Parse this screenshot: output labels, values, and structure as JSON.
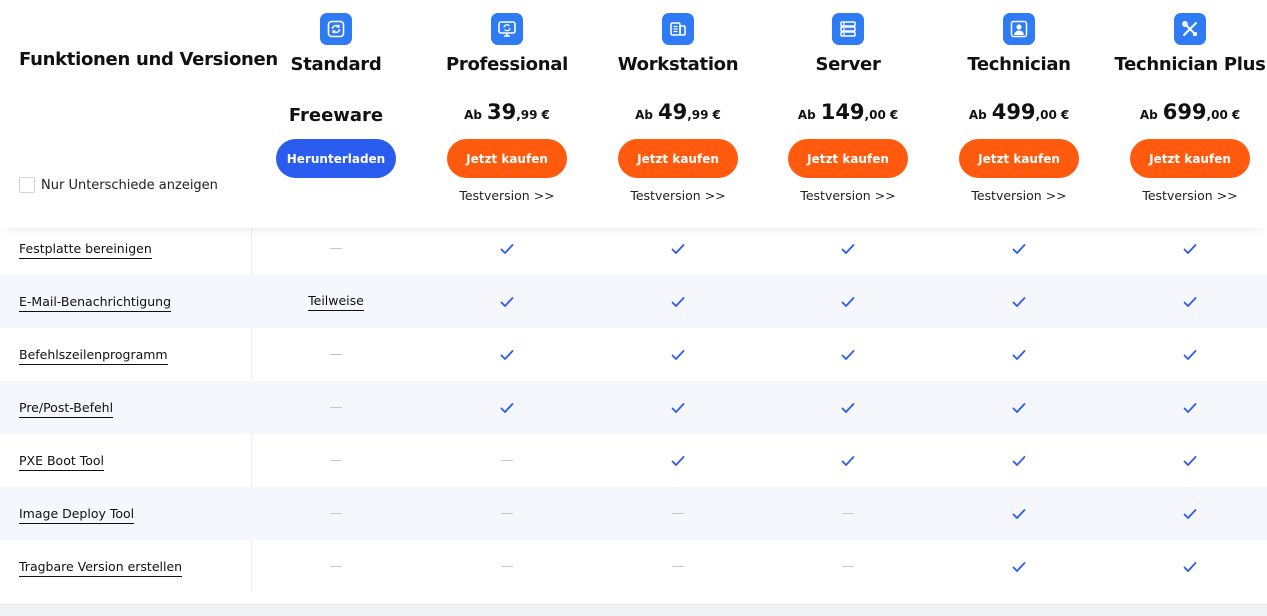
{
  "title": "Funktionen und Versionen",
  "diff_checkbox_label": "Nur Unterschiede anzeigen",
  "editions": [
    {
      "name": "Standard",
      "icon": "refresh-icon",
      "freeware": "Freeware",
      "button": "Herunterladen",
      "button_color": "#2a5cf0"
    },
    {
      "name": "Professional",
      "icon": "monitor-refresh-icon",
      "ab": "Ab",
      "price_int": "39",
      "price_dec": ",99",
      "currency": "€",
      "button": "Jetzt kaufen",
      "button_color": "#ff5a0e",
      "trial": "Testversion >>"
    },
    {
      "name": "Workstation",
      "icon": "workstation-icon",
      "ab": "Ab",
      "price_int": "49",
      "price_dec": ",99",
      "currency": "€",
      "button": "Jetzt kaufen",
      "button_color": "#ff5a0e",
      "trial": "Testversion >>"
    },
    {
      "name": "Server",
      "icon": "server-icon",
      "ab": "Ab",
      "price_int": "149",
      "price_dec": ",00",
      "currency": "€",
      "button": "Jetzt kaufen",
      "button_color": "#ff5a0e",
      "trial": "Testversion >>"
    },
    {
      "name": "Technician",
      "icon": "user-icon",
      "ab": "Ab",
      "price_int": "499",
      "price_dec": ",00",
      "currency": "€",
      "button": "Jetzt kaufen",
      "button_color": "#ff5a0e",
      "trial": "Testversion >>"
    },
    {
      "name": "Technician Plus",
      "icon": "tools-icon",
      "ab": "Ab",
      "price_int": "699",
      "price_dec": ",00",
      "currency": "€",
      "button": "Jetzt kaufen",
      "button_color": "#ff5a0e",
      "trial": "Testversion >>"
    }
  ],
  "features": [
    {
      "name": "Festplatte bereinigen",
      "values": [
        "no",
        "yes",
        "yes",
        "yes",
        "yes",
        "yes"
      ]
    },
    {
      "name": "E-Mail-Benachrichtigung",
      "values": [
        "Teilweise",
        "yes",
        "yes",
        "yes",
        "yes",
        "yes"
      ]
    },
    {
      "name": "Befehlszeilenprogramm",
      "values": [
        "no",
        "yes",
        "yes",
        "yes",
        "yes",
        "yes"
      ]
    },
    {
      "name": "Pre/Post-Befehl",
      "values": [
        "no",
        "yes",
        "yes",
        "yes",
        "yes",
        "yes"
      ]
    },
    {
      "name": "PXE Boot Tool",
      "values": [
        "no",
        "no",
        "yes",
        "yes",
        "yes",
        "yes"
      ]
    },
    {
      "name": "Image Deploy Tool",
      "values": [
        "no",
        "no",
        "no",
        "no",
        "yes",
        "yes"
      ]
    },
    {
      "name": "Tragbare Version erstellen",
      "values": [
        "no",
        "no",
        "no",
        "no",
        "yes",
        "yes"
      ]
    }
  ],
  "colors": {
    "check": "#2a5cf0",
    "dash": "#c4c8cf",
    "icon_bg": "#2f7bf5",
    "row_alt": "#f5f7fd"
  }
}
